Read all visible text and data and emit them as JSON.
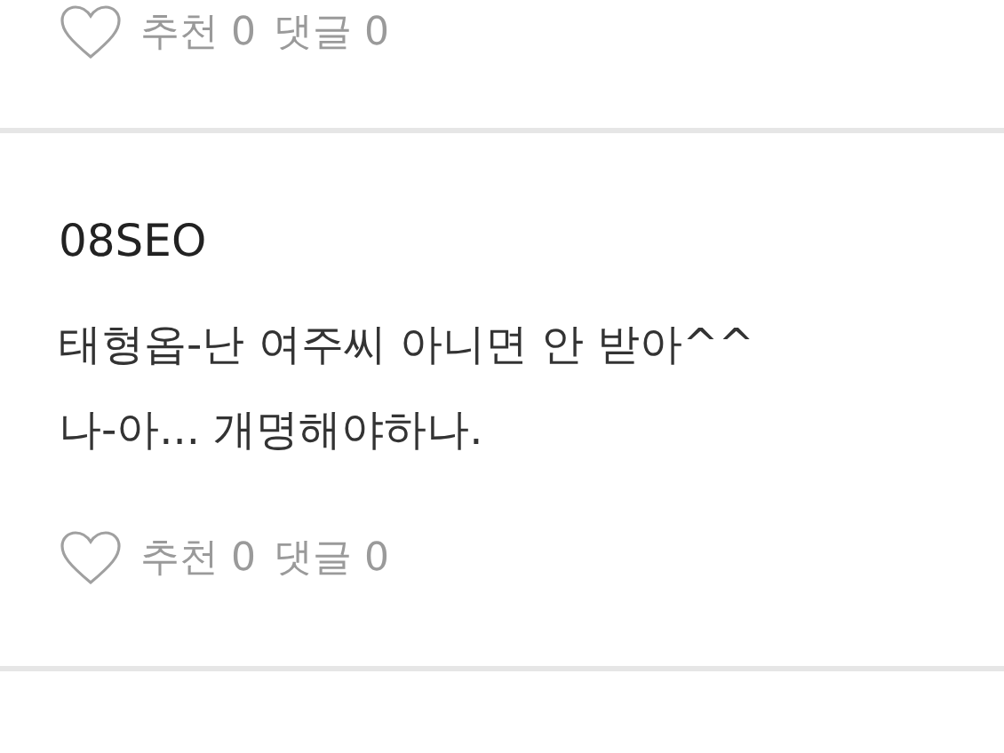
{
  "comments": [
    {
      "likes": "추천 0",
      "replies": "댓글 0"
    },
    {
      "author": "08SEO",
      "body": "태형옵-난 여주씨 아니면 안 받아^^\n나-아... 개명해야하나.",
      "likes": "추천 0",
      "replies": "댓글 0"
    }
  ]
}
